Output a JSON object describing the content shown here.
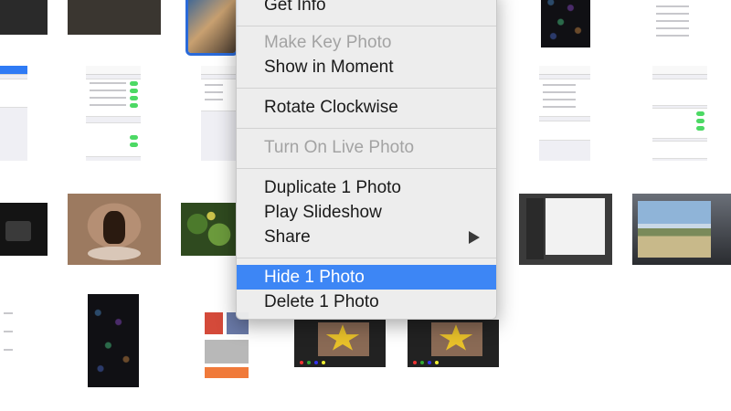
{
  "context_menu": {
    "items": [
      {
        "label": "Get Info"
      },
      {
        "label": "Make Key Photo"
      },
      {
        "label": "Show in Moment"
      },
      {
        "label": "Rotate Clockwise"
      },
      {
        "label": "Turn On Live Photo"
      },
      {
        "label": "Duplicate 1 Photo"
      },
      {
        "label": "Play Slideshow"
      },
      {
        "label": "Share"
      },
      {
        "label": "Hide 1 Photo"
      },
      {
        "label": "Delete 1 Photo"
      }
    ],
    "submenu_indicator": "triangle-right-icon",
    "highlight_color": "#3d86f5",
    "disabled_color": "#a3a3a3"
  },
  "selection_color": "#2a6ad9"
}
